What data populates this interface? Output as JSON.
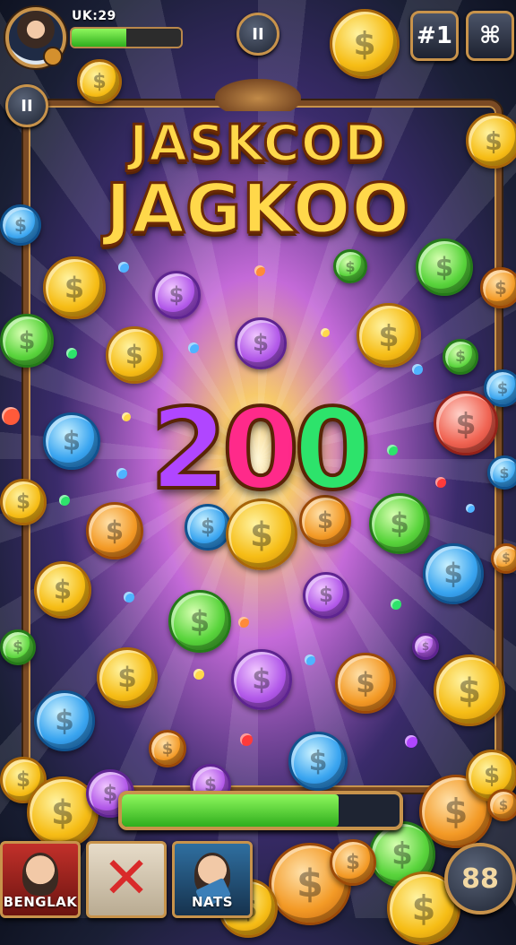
{
  "hud": {
    "player_id": "UK:29",
    "health_fill": 0.5,
    "top_pause_label": "II",
    "left_pause_label": "II",
    "rank_button_label": "#1",
    "settings_button_label": "⌘"
  },
  "title": {
    "line1": "JASKCOD",
    "line2": "JAGKOO"
  },
  "jackpot_value_digits": [
    "2",
    "0",
    "0"
  ],
  "progress_fill": 0.78,
  "bottom_bar": {
    "card1_label": "BENGLAK",
    "card2_label": "",
    "card3_label": "NATS",
    "score": "88"
  },
  "coin_symbol": "$",
  "colors": {
    "frame": "#7a4a24",
    "accent_gold": "#c8934b",
    "bar_green": "#4fd02e",
    "title_gold": "#ffd84a"
  }
}
